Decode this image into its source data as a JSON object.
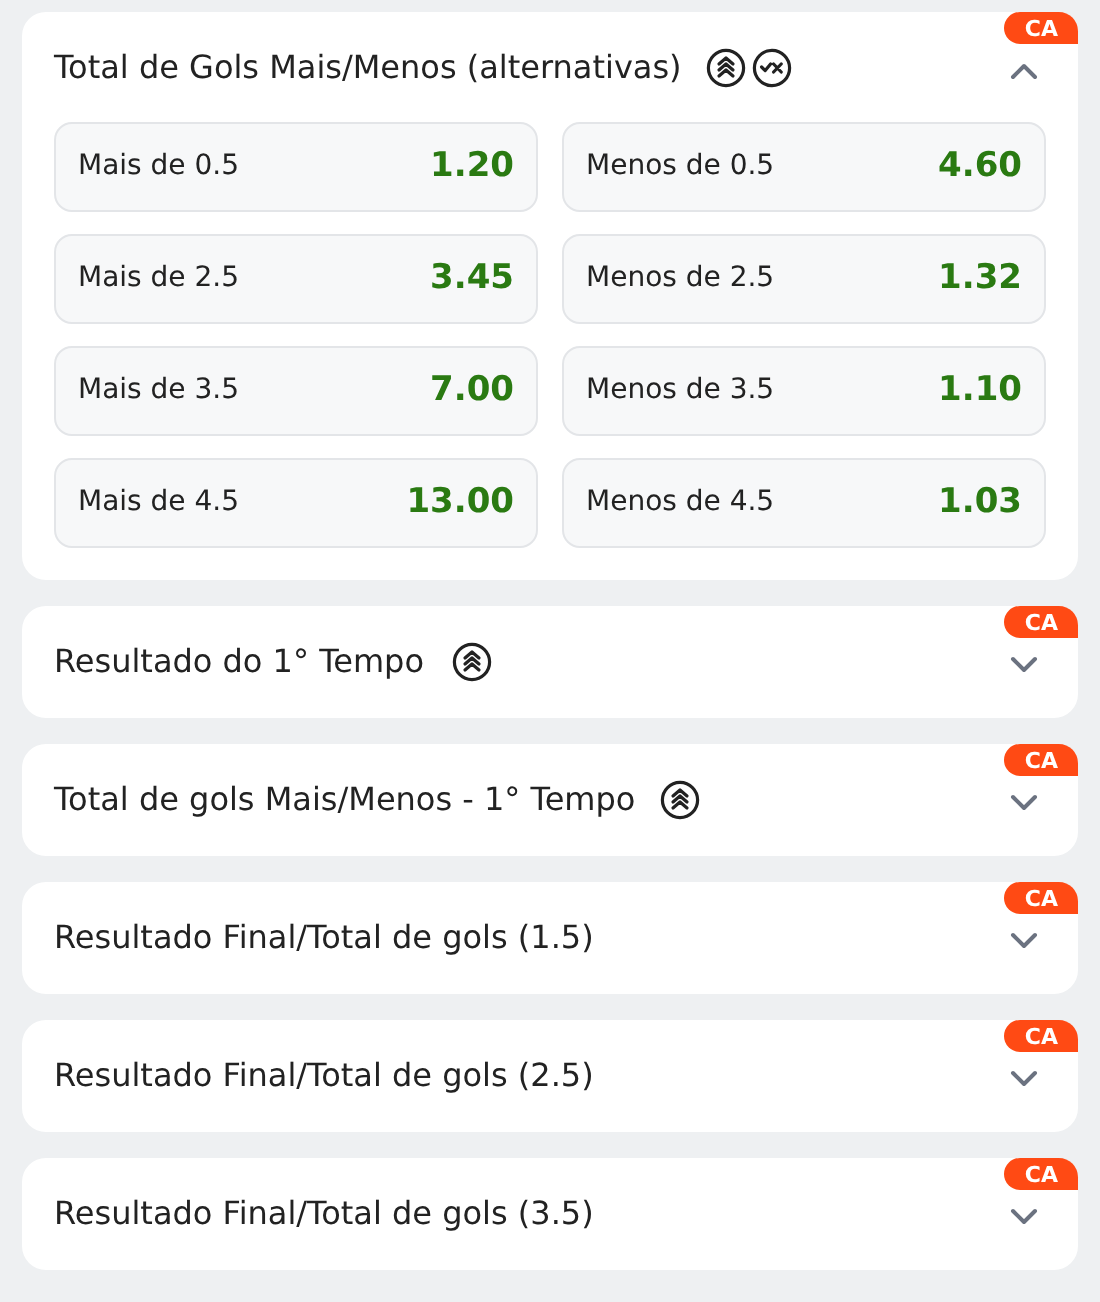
{
  "markets": [
    {
      "title": "Total de Gols Mais/Menos (alternativas)",
      "badge": "CA",
      "boost": true,
      "cashout": true,
      "expanded": true,
      "options": [
        {
          "label": "Mais de 0.5",
          "odds": "1.20"
        },
        {
          "label": "Menos de 0.5",
          "odds": "4.60"
        },
        {
          "label": "Mais de 2.5",
          "odds": "3.45"
        },
        {
          "label": "Menos de 2.5",
          "odds": "1.32"
        },
        {
          "label": "Mais de 3.5",
          "odds": "7.00"
        },
        {
          "label": "Menos de 3.5",
          "odds": "1.10"
        },
        {
          "label": "Mais de 4.5",
          "odds": "13.00"
        },
        {
          "label": "Menos de 4.5",
          "odds": "1.03"
        }
      ]
    },
    {
      "title": "Resultado do 1° Tempo",
      "badge": "CA",
      "boost": true,
      "cashout": false,
      "expanded": false
    },
    {
      "title": "Total de gols Mais/Menos - 1° Tempo",
      "badge": "CA",
      "boost": true,
      "cashout": false,
      "expanded": false
    },
    {
      "title": "Resultado Final/Total de gols (1.5)",
      "badge": "CA",
      "boost": false,
      "cashout": false,
      "expanded": false
    },
    {
      "title": "Resultado Final/Total de gols (2.5)",
      "badge": "CA",
      "boost": false,
      "cashout": false,
      "expanded": false
    },
    {
      "title": "Resultado Final/Total de gols (3.5)",
      "badge": "CA",
      "boost": false,
      "cashout": false,
      "expanded": false
    }
  ]
}
